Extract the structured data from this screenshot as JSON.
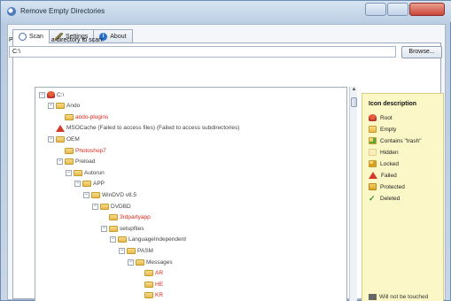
{
  "window": {
    "title": "Remove Empty Directories"
  },
  "tabs": [
    {
      "label": "Scan",
      "icon": "search-icon",
      "active": true
    },
    {
      "label": "Settings",
      "icon": "wrench-icon",
      "active": false
    },
    {
      "label": "About",
      "icon": "info-icon",
      "active": false
    }
  ],
  "scan": {
    "prompt": "Please choose a directory to scan:",
    "path_value": "C:\\",
    "browse_label": "Browse..."
  },
  "tree": [
    {
      "label": "C:\\",
      "kind": "root"
    },
    {
      "label": "Ando",
      "kind": "normal"
    },
    {
      "label": "ando-plugins",
      "kind": "empty"
    },
    {
      "label": "MSOCache (Failed to access files) (Failed to access subdirectories)",
      "kind": "failed"
    },
    {
      "label": "OEM",
      "kind": "normal"
    },
    {
      "label": "Photoshop7",
      "kind": "empty"
    },
    {
      "label": "Preload",
      "kind": "normal"
    },
    {
      "label": "Autorun",
      "kind": "normal"
    },
    {
      "label": "APP",
      "kind": "normal"
    },
    {
      "label": "WinDVD v8.5",
      "kind": "normal"
    },
    {
      "label": "DVDBD",
      "kind": "normal"
    },
    {
      "label": "3rdpartyapp",
      "kind": "empty"
    },
    {
      "label": "setupfiles",
      "kind": "normal"
    },
    {
      "label": "LanguageIndependent",
      "kind": "normal"
    },
    {
      "label": "PASM",
      "kind": "normal"
    },
    {
      "label": "Messages",
      "kind": "normal"
    },
    {
      "label": "AR",
      "kind": "empty"
    },
    {
      "label": "HE",
      "kind": "empty"
    },
    {
      "label": "KR",
      "kind": "empty"
    }
  ],
  "legend": {
    "title": "Icon description",
    "items": [
      {
        "label": "Root",
        "icon": "root-icon"
      },
      {
        "label": "Empty",
        "icon": "empty-folder-icon"
      },
      {
        "label": "Contains \"trash\"",
        "icon": "trash-folder-icon"
      },
      {
        "label": "Hidden",
        "icon": "hidden-folder-icon"
      },
      {
        "label": "Locked",
        "icon": "locked-folder-icon"
      },
      {
        "label": "Failed",
        "icon": "failed-icon"
      },
      {
        "label": "Protected",
        "icon": "protected-icon"
      },
      {
        "label": "Deleted",
        "icon": "deleted-check-icon"
      }
    ],
    "footer": "Will not be touched"
  },
  "colors": {
    "empty_text": "#e0261b",
    "normal_text": "#444444",
    "legend_bg": "#fbf7c7"
  }
}
